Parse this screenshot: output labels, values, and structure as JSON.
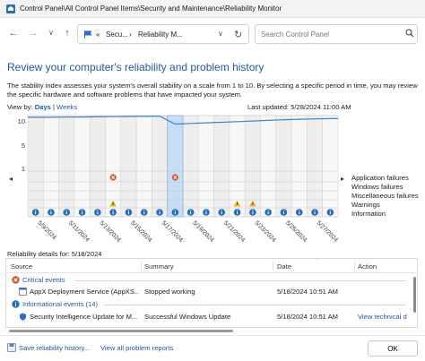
{
  "window": {
    "title": "Control Panel\\All Control Panel Items\\Security and Maintenance\\Reliability Monitor"
  },
  "nav": {
    "back_glyph": "←",
    "forward_glyph": "→",
    "recent_glyph": "∨",
    "up_glyph": "↑",
    "address": {
      "sep": "«",
      "crumb1": "Secu...",
      "crumb2": "Reliability M...",
      "crumb_sep": "›"
    },
    "search_placeholder": "Search Control Panel"
  },
  "page": {
    "title": "Review your computer's reliability and problem history",
    "description": "The stability index assesses your system's overall stability on a scale from 1 to 10. By selecting a specific period in time, you may review the specific hardware and software problems that have impacted your system.",
    "view_by_label": "View by:",
    "view_days": "Days",
    "view_weeks": "Weeks",
    "last_updated": "Last updated: 5/28/2024 11:00 AM"
  },
  "chart_data": {
    "type": "line",
    "title": "",
    "y_ticks": [
      "10",
      "5",
      "1"
    ],
    "ylim": [
      1,
      10
    ],
    "x": [
      "5/9/2024",
      "5/10/2024",
      "5/11/2024",
      "5/12/2024",
      "5/13/2024",
      "5/14/2024",
      "5/15/2024",
      "5/16/2024",
      "5/17/2024",
      "5/18/2024",
      "5/19/2024",
      "5/20/2024",
      "5/21/2024",
      "5/22/2024",
      "5/23/2024",
      "5/24/2024",
      "5/25/2024",
      "5/26/2024",
      "5/27/2024",
      "5/28/2024"
    ],
    "x_tick_labels": [
      "5/9/2024",
      "5/11/2024",
      "5/13/2024",
      "5/15/2024",
      "5/17/2024",
      "5/19/2024",
      "5/21/2024",
      "5/23/2024",
      "5/25/2024",
      "5/27/2024"
    ],
    "stability_index": [
      9.7,
      9.72,
      9.75,
      9.77,
      9.8,
      9.82,
      9.85,
      9.87,
      9.9,
      8.6,
      8.7,
      8.8,
      8.9,
      9.0,
      9.1,
      9.2,
      9.3,
      9.4,
      9.45,
      9.5
    ],
    "selected_index": 9,
    "rows": [
      "Application failures",
      "Windows failures",
      "Miscellaneous failures",
      "Warnings",
      "Information"
    ],
    "critical_days": [
      5,
      9
    ],
    "warning_days": [
      5,
      13,
      14
    ],
    "information_days": [
      0,
      1,
      2,
      3,
      4,
      5,
      6,
      7,
      8,
      9,
      10,
      11,
      12,
      13,
      14,
      15,
      16,
      17,
      18,
      19
    ],
    "colors": {
      "line": "#3a85c9",
      "selected": "#c7ddf4",
      "critical": "#d9532c",
      "warning": "#f0b400",
      "info": "#1e6fc2"
    }
  },
  "details": {
    "header": "Reliability details for: 5/18/2024",
    "columns": [
      "Source",
      "Summary",
      "Date",
      "Action"
    ],
    "critical_group": "Critical events",
    "info_group": "Informational events (14)",
    "rows": [
      {
        "source": "AppX Deployment Service (AppXS...",
        "summary": "Stopped working",
        "date": "5/18/2024 10:51 AM",
        "action": ""
      },
      {
        "source": "Security Intelligence Update for M...",
        "summary": "Successful Windows Update",
        "date": "5/18/2024 10:51 AM",
        "action": "View technical d"
      }
    ]
  },
  "footer": {
    "save_link": "Save reliability history...",
    "view_all_link": "View all problem reports",
    "ok": "OK"
  }
}
